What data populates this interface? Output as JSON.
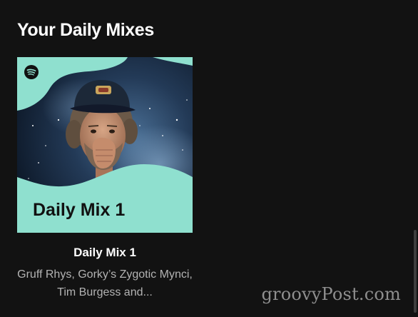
{
  "section": {
    "title": "Your Daily Mixes"
  },
  "mixes": [
    {
      "name": "Daily Mix 1",
      "cover_label": "Daily Mix 1",
      "description": "Gruff Rhys, Gorky’s Zygotic Mynci, Tim Burgess and...",
      "cover_accent": "#8fe0cf",
      "logo_icon": "spotify-icon"
    }
  ],
  "watermark": "groovyPost.com"
}
